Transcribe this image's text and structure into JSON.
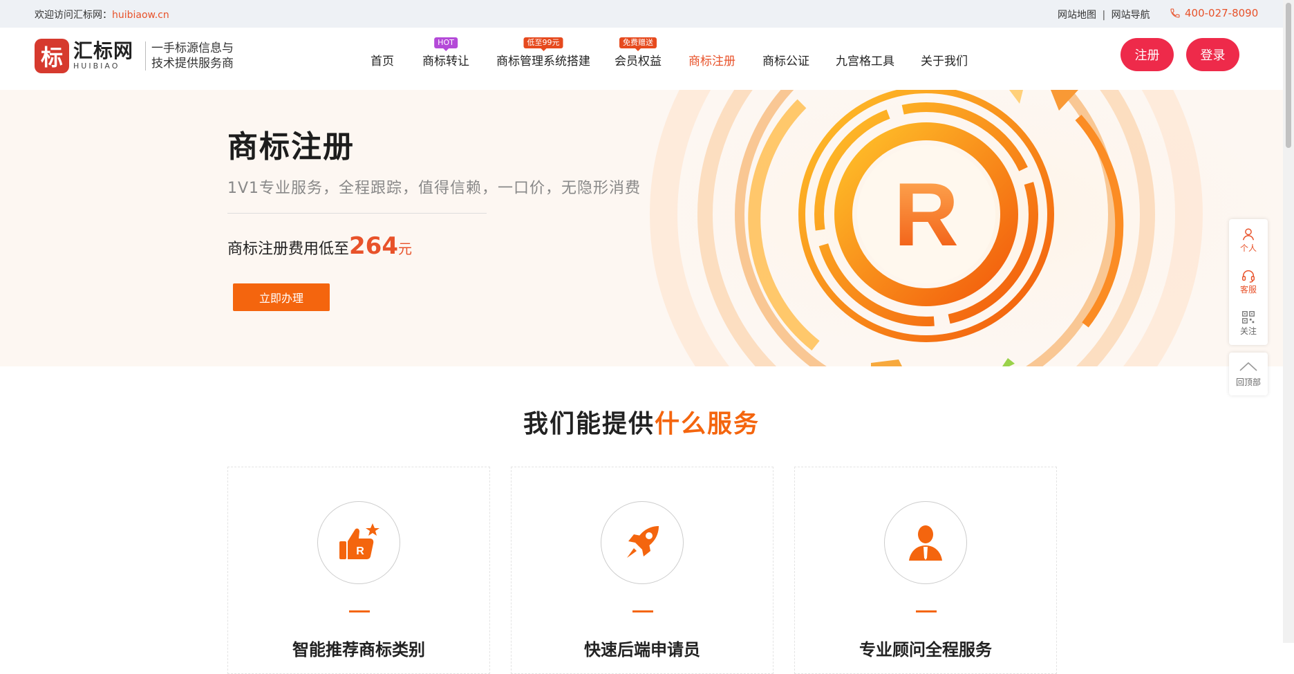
{
  "topbar": {
    "welcome": "欢迎访问汇标网：",
    "site": "huibiaow.cn",
    "sitemap": "网站地图",
    "separator": "|",
    "site_nav": "网站导航",
    "phone": "400-027-8090"
  },
  "logo": {
    "mark": "标",
    "name": "汇标网",
    "en": "HUIBIAO",
    "slogan_line1": "一手标源信息与",
    "slogan_line2": "技术提供服务商"
  },
  "nav": {
    "items": [
      {
        "label": "首页",
        "badge": ""
      },
      {
        "label": "商标转让",
        "badge": "HOT"
      },
      {
        "label": "商标管理系统搭建",
        "badge": "低至99元"
      },
      {
        "label": "会员权益",
        "badge": "免费赠送"
      },
      {
        "label": "商标注册",
        "badge": ""
      },
      {
        "label": "商标公证",
        "badge": ""
      },
      {
        "label": "九宫格工具",
        "badge": ""
      },
      {
        "label": "关于我们",
        "badge": ""
      }
    ],
    "active": "商标注册",
    "register": "注册",
    "login": "登录"
  },
  "hero": {
    "title": "商标注册",
    "subtitle": "1V1专业服务，全程跟踪，值得信赖，一口价，无隐形消费",
    "price_prefix": "商标注册费用低至",
    "price": "264",
    "price_unit": "元",
    "cta": "立即办理",
    "emblem_letter": "R"
  },
  "side_tools": {
    "personal": "个人",
    "service": "客服",
    "follow": "关注",
    "back_top": "回顶部"
  },
  "services": {
    "title_prefix": "我们能提供",
    "title_highlight": "什么服务",
    "cards": [
      {
        "title": "智能推荐商标类别",
        "icon": "thumbs-up-icon"
      },
      {
        "title": "快速后端申请员",
        "icon": "rocket-icon"
      },
      {
        "title": "专业顾问全程服务",
        "icon": "consultant-icon"
      }
    ]
  },
  "colors": {
    "accent": "#f4650e",
    "brand_red": "#ee2a4a",
    "active_nav": "#e8522a"
  }
}
